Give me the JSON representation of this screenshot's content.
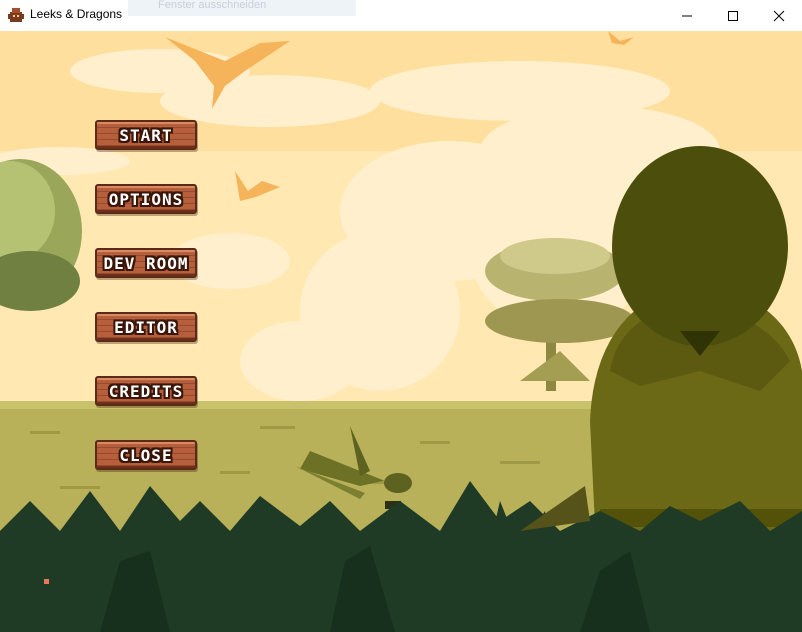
{
  "window": {
    "title": "Leeks & Dragons",
    "ghost_text": "Fenster ausschneiden"
  },
  "controls": {
    "minimize": "minimize",
    "maximize": "maximize",
    "close": "close"
  },
  "menu": {
    "items": [
      {
        "label": "START"
      },
      {
        "label": "OPTIONS"
      },
      {
        "label": "DEV ROOM"
      },
      {
        "label": "EDITOR"
      },
      {
        "label": "CREDITS"
      },
      {
        "label": "CLOSE"
      }
    ]
  },
  "colors": {
    "sky": "#ffe7b0",
    "button": "#b55f3d",
    "foliage": "#1f3a25",
    "grass": "#b8b15a",
    "character": "#5c5a10"
  }
}
